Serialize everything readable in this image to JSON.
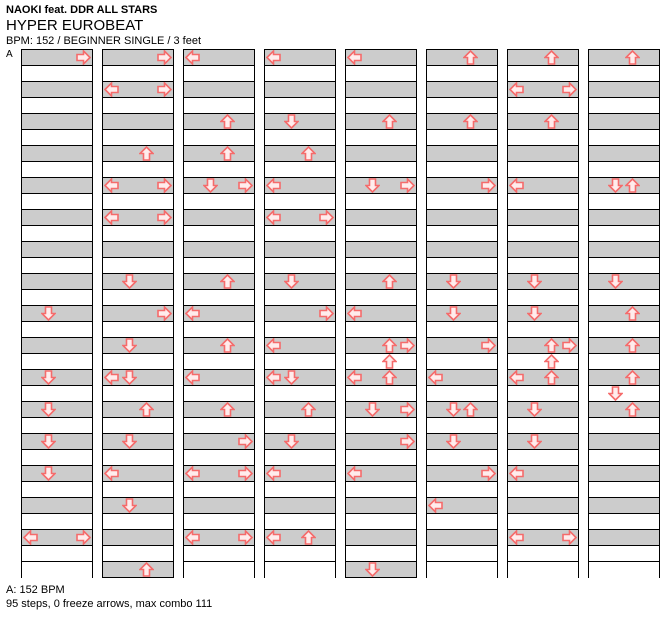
{
  "header": {
    "artist": "NAOKI feat. DDR ALL STARS",
    "title": "HYPER EUROBEAT",
    "meta": "BPM: 152 / BEGINNER SINGLE / 3 feet"
  },
  "marker": "A",
  "footer": {
    "bpm": "A: 152 BPM",
    "stats": "95 steps, 0 freeze arrows, max combo 111"
  },
  "chart_data": {
    "type": "stepchart",
    "rows_per_column": 32,
    "columns": 8,
    "lanes": [
      "left",
      "down",
      "up",
      "right"
    ],
    "arrow_color": "#f56b6b",
    "steps": [
      [
        {
          "row": 0,
          "dirs": [
            "right"
          ]
        },
        {
          "row": 16,
          "dirs": [
            "down"
          ]
        },
        {
          "row": 20,
          "dirs": [
            "down"
          ]
        },
        {
          "row": 22,
          "dirs": [
            "down"
          ]
        },
        {
          "row": 24,
          "dirs": [
            "down"
          ]
        },
        {
          "row": 26,
          "dirs": [
            "down"
          ]
        },
        {
          "row": 30,
          "dirs": [
            "left",
            "right"
          ]
        }
      ],
      [
        {
          "row": 0,
          "dirs": [
            "right"
          ]
        },
        {
          "row": 2,
          "dirs": [
            "left",
            "right"
          ]
        },
        {
          "row": 6,
          "dirs": [
            "up"
          ]
        },
        {
          "row": 8,
          "dirs": [
            "left",
            "right"
          ]
        },
        {
          "row": 10,
          "dirs": [
            "left",
            "right"
          ]
        },
        {
          "row": 14,
          "dirs": [
            "down"
          ]
        },
        {
          "row": 16,
          "dirs": [
            "right"
          ]
        },
        {
          "row": 18,
          "dirs": [
            "down"
          ]
        },
        {
          "row": 20,
          "dirs": [
            "left",
            "down"
          ]
        },
        {
          "row": 22,
          "dirs": [
            "up"
          ]
        },
        {
          "row": 24,
          "dirs": [
            "down"
          ]
        },
        {
          "row": 26,
          "dirs": [
            "left"
          ]
        },
        {
          "row": 28,
          "dirs": [
            "down"
          ]
        },
        {
          "row": 32,
          "dirs": [
            "up"
          ]
        }
      ],
      [
        {
          "row": 0,
          "dirs": [
            "left"
          ]
        },
        {
          "row": 4,
          "dirs": [
            "up"
          ]
        },
        {
          "row": 6,
          "dirs": [
            "up"
          ]
        },
        {
          "row": 8,
          "dirs": [
            "down",
            "right"
          ]
        },
        {
          "row": 14,
          "dirs": [
            "up"
          ]
        },
        {
          "row": 16,
          "dirs": [
            "left"
          ]
        },
        {
          "row": 18,
          "dirs": [
            "up"
          ]
        },
        {
          "row": 20,
          "dirs": [
            "left"
          ]
        },
        {
          "row": 22,
          "dirs": [
            "up"
          ]
        },
        {
          "row": 24,
          "dirs": [
            "right"
          ]
        },
        {
          "row": 26,
          "dirs": [
            "left",
            "right"
          ]
        },
        {
          "row": 30,
          "dirs": [
            "left",
            "right"
          ]
        }
      ],
      [
        {
          "row": 0,
          "dirs": [
            "left"
          ]
        },
        {
          "row": 4,
          "dirs": [
            "down"
          ]
        },
        {
          "row": 6,
          "dirs": [
            "up"
          ]
        },
        {
          "row": 8,
          "dirs": [
            "left"
          ]
        },
        {
          "row": 10,
          "dirs": [
            "left",
            "right"
          ]
        },
        {
          "row": 14,
          "dirs": [
            "down"
          ]
        },
        {
          "row": 16,
          "dirs": [
            "right"
          ]
        },
        {
          "row": 18,
          "dirs": [
            "left"
          ]
        },
        {
          "row": 20,
          "dirs": [
            "left",
            "down"
          ]
        },
        {
          "row": 22,
          "dirs": [
            "up"
          ]
        },
        {
          "row": 24,
          "dirs": [
            "down"
          ]
        },
        {
          "row": 26,
          "dirs": [
            "left"
          ]
        },
        {
          "row": 30,
          "dirs": [
            "left",
            "up"
          ]
        }
      ],
      [
        {
          "row": 0,
          "dirs": [
            "left"
          ]
        },
        {
          "row": 4,
          "dirs": [
            "up"
          ]
        },
        {
          "row": 8,
          "dirs": [
            "down",
            "right"
          ]
        },
        {
          "row": 14,
          "dirs": [
            "up"
          ]
        },
        {
          "row": 16,
          "dirs": [
            "left"
          ]
        },
        {
          "row": 18,
          "dirs": [
            "up",
            "right"
          ]
        },
        {
          "row": 19,
          "dirs": [
            "up"
          ]
        },
        {
          "row": 20,
          "dirs": [
            "left",
            "up"
          ]
        },
        {
          "row": 22,
          "dirs": [
            "down",
            "right"
          ]
        },
        {
          "row": 24,
          "dirs": [
            "right"
          ]
        },
        {
          "row": 26,
          "dirs": [
            "left"
          ]
        },
        {
          "row": 32,
          "dirs": [
            "down"
          ]
        }
      ],
      [
        {
          "row": 0,
          "dirs": [
            "up"
          ]
        },
        {
          "row": 4,
          "dirs": [
            "up"
          ]
        },
        {
          "row": 8,
          "dirs": [
            "right"
          ]
        },
        {
          "row": 14,
          "dirs": [
            "down"
          ]
        },
        {
          "row": 16,
          "dirs": [
            "down"
          ]
        },
        {
          "row": 18,
          "dirs": [
            "right"
          ]
        },
        {
          "row": 20,
          "dirs": [
            "left"
          ]
        },
        {
          "row": 22,
          "dirs": [
            "down",
            "up"
          ]
        },
        {
          "row": 24,
          "dirs": [
            "down"
          ]
        },
        {
          "row": 26,
          "dirs": [
            "right"
          ]
        },
        {
          "row": 28,
          "dirs": [
            "left"
          ]
        }
      ],
      [
        {
          "row": 0,
          "dirs": [
            "up"
          ]
        },
        {
          "row": 2,
          "dirs": [
            "left",
            "right"
          ]
        },
        {
          "row": 4,
          "dirs": [
            "up"
          ]
        },
        {
          "row": 8,
          "dirs": [
            "left"
          ]
        },
        {
          "row": 14,
          "dirs": [
            "down"
          ]
        },
        {
          "row": 16,
          "dirs": [
            "down"
          ]
        },
        {
          "row": 18,
          "dirs": [
            "up",
            "right"
          ]
        },
        {
          "row": 19,
          "dirs": [
            "up"
          ]
        },
        {
          "row": 20,
          "dirs": [
            "left",
            "up"
          ]
        },
        {
          "row": 22,
          "dirs": [
            "down"
          ]
        },
        {
          "row": 24,
          "dirs": [
            "down"
          ]
        },
        {
          "row": 26,
          "dirs": [
            "left"
          ]
        },
        {
          "row": 30,
          "dirs": [
            "left",
            "right"
          ]
        }
      ],
      [
        {
          "row": 0,
          "dirs": [
            "up"
          ]
        },
        {
          "row": 8,
          "dirs": [
            "down",
            "up"
          ]
        },
        {
          "row": 14,
          "dirs": [
            "down"
          ]
        },
        {
          "row": 16,
          "dirs": [
            "up"
          ]
        },
        {
          "row": 18,
          "dirs": [
            "up"
          ]
        },
        {
          "row": 20,
          "dirs": [
            "up"
          ]
        },
        {
          "row": 21,
          "dirs": [
            "down"
          ]
        },
        {
          "row": 22,
          "dirs": [
            "up"
          ]
        }
      ]
    ]
  }
}
